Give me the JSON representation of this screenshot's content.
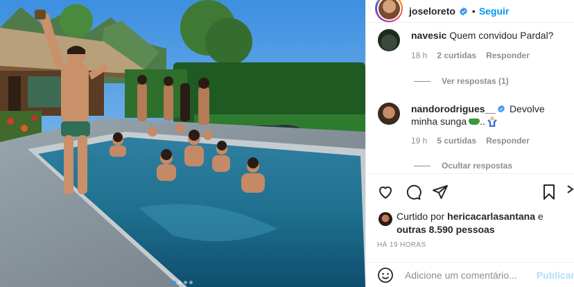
{
  "post": {
    "image_alt": "Group of people celebrating in a swimming pool",
    "carousel": {
      "count": 4,
      "active_index": 0
    },
    "colors": {
      "link": "#0095f6",
      "muted": "#8e8e8e",
      "publish_disabled": "#b2dffc"
    }
  },
  "header": {
    "username": "joseloreto",
    "separator": "•",
    "follow_label": "Seguir"
  },
  "comments": [
    {
      "username": "navesic",
      "text": "Quem convidou Pardal?",
      "time": "18 h",
      "likes": "2 curtidas",
      "reply_label": "Responder",
      "replies_toggle": "Ver respostas (1)"
    },
    {
      "username": "nandorodrigues__",
      "text_line1": "Devolve",
      "text_line2": "minha sunga",
      "time": "19 h",
      "likes": "5 curtidas",
      "reply_label": "Responder",
      "replies_toggle": "Ocultar respostas"
    }
  ],
  "likes": {
    "prefix": "Curtido por",
    "user": "hericacarlasantana",
    "joiner": "e",
    "others": "outras 8.590 pessoas"
  },
  "timestamp": "HÁ 19 HORAS",
  "add_comment": {
    "placeholder": "Adicione um comentário...",
    "publish_label": "Publicar"
  },
  "icons": [
    "heart-icon",
    "comment-icon",
    "share-icon",
    "bookmark-icon",
    "emoji-icon",
    "verified-icon"
  ]
}
